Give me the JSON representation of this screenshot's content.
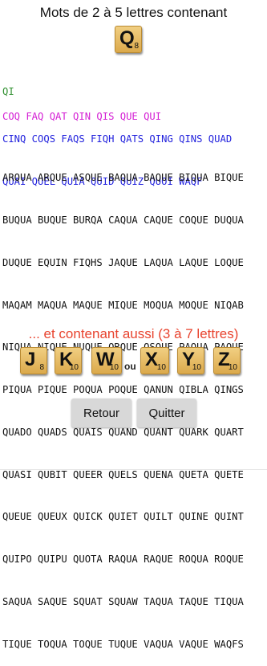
{
  "title": "Mots de 2 à 5 lettres contenant",
  "main_tile": {
    "letter": "Q",
    "points": "8"
  },
  "groups": {
    "two": [
      "QI"
    ],
    "three": [
      "COQ FAQ QAT QIN QIS QUE QUI"
    ],
    "four": [
      "CINQ COQS FAQS FIQH QATS QING QINS QUAD",
      "QUAI QUEL QUIA QUID QUIZ QUOI WAQF"
    ],
    "five": [
      "ARQUA ARQUE ASQUE BAQUA BAQUE BIQUA BIQUE",
      "BUQUA BUQUE BURQA CAQUA CAQUE COQUE DUQUA",
      "DUQUE EQUIN FIQHS JAQUE LAQUA LAQUE LOQUE",
      "MAQAM MAQUA MAQUE MIQUE MOQUA MOQUE NIQAB",
      "NIQUA NIQUE NUQUE ORQUE OSQUE PAQUA PAQUE",
      "PIQUA PIQUE POQUA POQUE QANUN QIBLA QINGS",
      "QUADO QUADS QUAIS QUAND QUANT QUARK QUART",
      "QUASI QUBIT QUEER QUELS QUENA QUETA QUETE",
      "QUEUE QUEUX QUICK QUIET QUILT QUINE QUINT",
      "QUIPO QUIPU QUOTA RAQUA RAQUE ROQUA ROQUE",
      "SAQUA SAQUE SQUAT SQUAW TAQUA TAQUE TIQUA",
      "TIQUE TOQUA TOQUE TUQUE VAQUA VAQUE WAQFS"
    ]
  },
  "also_text": "... et contenant aussi (3 à 7 lettres)",
  "tiles": [
    {
      "letter": "J",
      "points": "8"
    },
    {
      "letter": "K",
      "points": "10"
    },
    {
      "letter": "W",
      "points": "10"
    },
    {
      "letter": "X",
      "points": "10"
    },
    {
      "letter": "Y",
      "points": "10"
    },
    {
      "letter": "Z",
      "points": "10"
    }
  ],
  "ou": "ou",
  "buttons": {
    "back": "Retour",
    "quit": "Quitter"
  }
}
